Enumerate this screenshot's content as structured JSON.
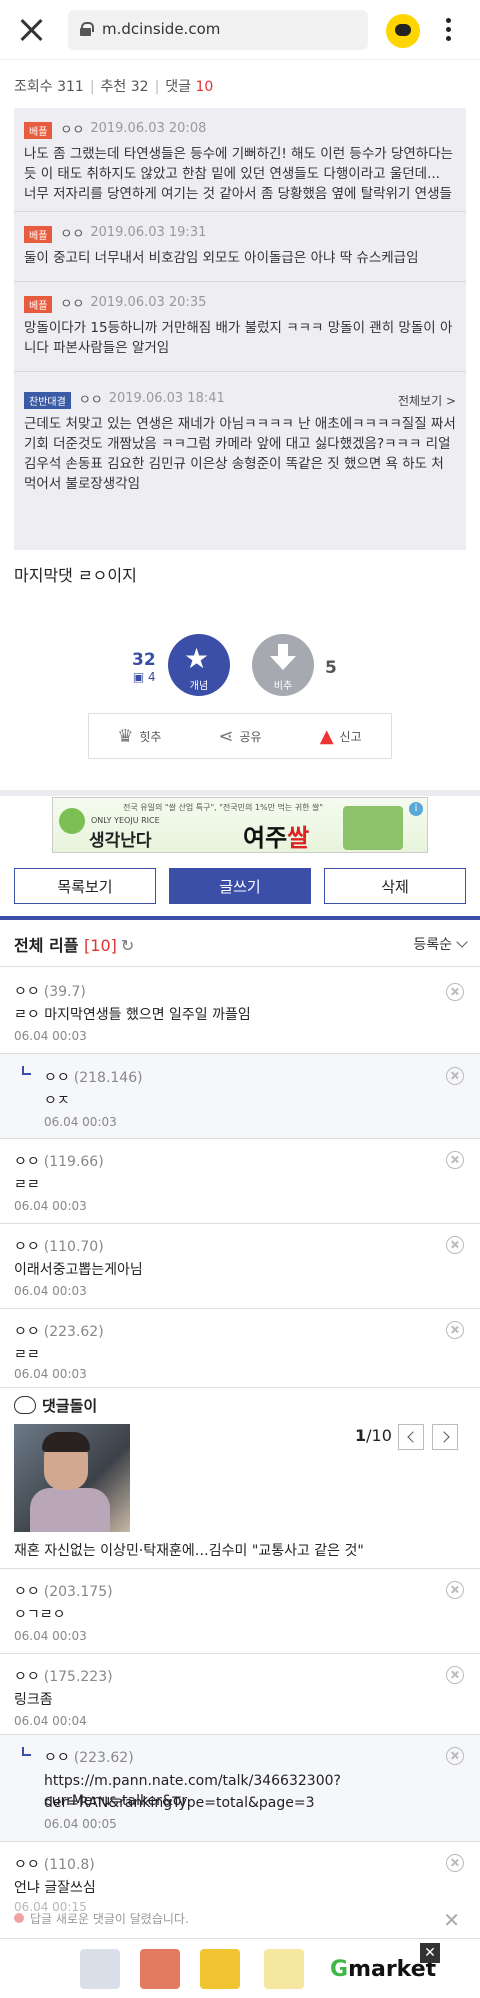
{
  "browser": {
    "url": "m.dcinside.com"
  },
  "stats": {
    "views_label": "조회수 311",
    "recommend_label": "추천 32",
    "comments_label": "댓글",
    "comments_count": "10"
  },
  "best_comments": [
    {
      "badge": "베플",
      "nick": "ㅇㅇ",
      "date": "2019.06.03 20:08",
      "text": "나도 좀 그랬는데 타연생들은 등수에 기뻐하긴! 해도 이런 등수가 당연하다는 듯 이 태도 취하지도 않았고 한참 밑에 있던 연생들도 다행이라고 울던데... 너무 저자리를 당연하게 여기는 것 같아서 좀 당황했음 옆에 탈락위기 연생들만 몇인데..."
    },
    {
      "badge": "베플",
      "nick": "ㅇㅇ",
      "date": "2019.06.03 19:31",
      "text": "둘이 중고티 너무내서 비호감임 외모도 아이돌급은 아냐 딱 슈스케급임"
    },
    {
      "badge": "베플",
      "nick": "ㅇㅇ",
      "date": "2019.06.03 20:35",
      "text": "망돌이다가 15등하니까 거만해짐 배가 불렀지 ㅋㅋㅋ 망돌이 괜히 망돌이 아니다 파본사람들은 알거임"
    },
    {
      "badge": "찬반대결",
      "nick": "ㅇㅇ",
      "date": "2019.06.03 18:41",
      "more": "전체보기 >",
      "text": "근데도 처맞고 있는 연생은 재네가 아님ㅋㅋㅋㅋ 난 애초에ㅋㅋㅋㅋ질질 짜서 기회 더준것도 개짬났음 ㅋㅋ그럼 카메라 앞에 대고 싫다했겠음?ㅋㅋㅋ 리얼 김우석 손동표 김요한 김민규 이은상 송형준이 똑같은 짓 했으면 욕 하도 처먹어서 불로장생각임"
    }
  ],
  "post_text": "마지막댓 ㄹㅇ이지",
  "votes": {
    "up": "32",
    "sub": "4",
    "up_label": "개념",
    "down_label": "비추",
    "down": "5"
  },
  "actions": {
    "hit": "힛추",
    "share": "공유",
    "report": "신고"
  },
  "ad": {
    "top": "전국 유일의 \"쌀 산업 특구\", \"전국민의 1%만 먹는 귀한 쌀\"",
    "en": "ONLY YEOJU RICE",
    "main": "생각난다",
    "brand1": "여주",
    "brand2": "쌀"
  },
  "buttons": {
    "list": "목록보기",
    "write": "글쓰기",
    "delete": "삭제"
  },
  "comment_header": {
    "title": "전체 리플",
    "count": "[10]",
    "sort": "등록순"
  },
  "comments": [
    {
      "nick": "ㅇㅇ",
      "ip": "(39.7)",
      "text": "ㄹㅇ 마지막연생들 했으면 일주일 까플임",
      "time": "06.04 00:03"
    },
    {
      "nick": "ㅇㅇ",
      "ip": "(218.146)",
      "text": "ㅇㅈ",
      "time": "06.04 00:03"
    },
    {
      "nick": "ㅇㅇ",
      "ip": "(119.66)",
      "text": "ㄹㄹ",
      "time": "06.04 00:03"
    },
    {
      "nick": "ㅇㅇ",
      "ip": "(110.70)",
      "text": "이래서중고뽑는게아님",
      "time": "06.04 00:03"
    },
    {
      "nick": "ㅇㅇ",
      "ip": "(223.62)",
      "text": "ㄹㄹ",
      "time": "06.04 00:03"
    },
    {
      "nick": "ㅇㅇ",
      "ip": "(203.175)",
      "text": "ㅇㄱㄹㅇ",
      "time": "06.04 00:03"
    },
    {
      "nick": "ㅇㅇ",
      "ip": "(175.223)",
      "text": "링크좀",
      "time": "06.04 00:04"
    },
    {
      "nick": "ㅇㅇ",
      "ip": "(223.62)",
      "text1": "https://m.pann.nate.com/talk/346632300?currMenu=talker&or",
      "text2": "der=RAN&rankingType=total&page=3",
      "time": "06.04 00:05"
    },
    {
      "nick": "ㅇㅇ",
      "ip": "(110.8)",
      "text": "언냐 글잘쓰심",
      "time": "06.04 00:15"
    }
  ],
  "dcbot": {
    "title": "댓글돌이",
    "page_cur": "1",
    "page_total": "/10",
    "caption": "재혼 자신없는 이상민·탁재훈에…김수미 \"교통사고 같은 것\""
  },
  "toast": "답글 새로운 댓글이 달렸습니다.",
  "bottom_ad": {
    "brand": "Gmarke",
    "brand_accent": "G"
  }
}
